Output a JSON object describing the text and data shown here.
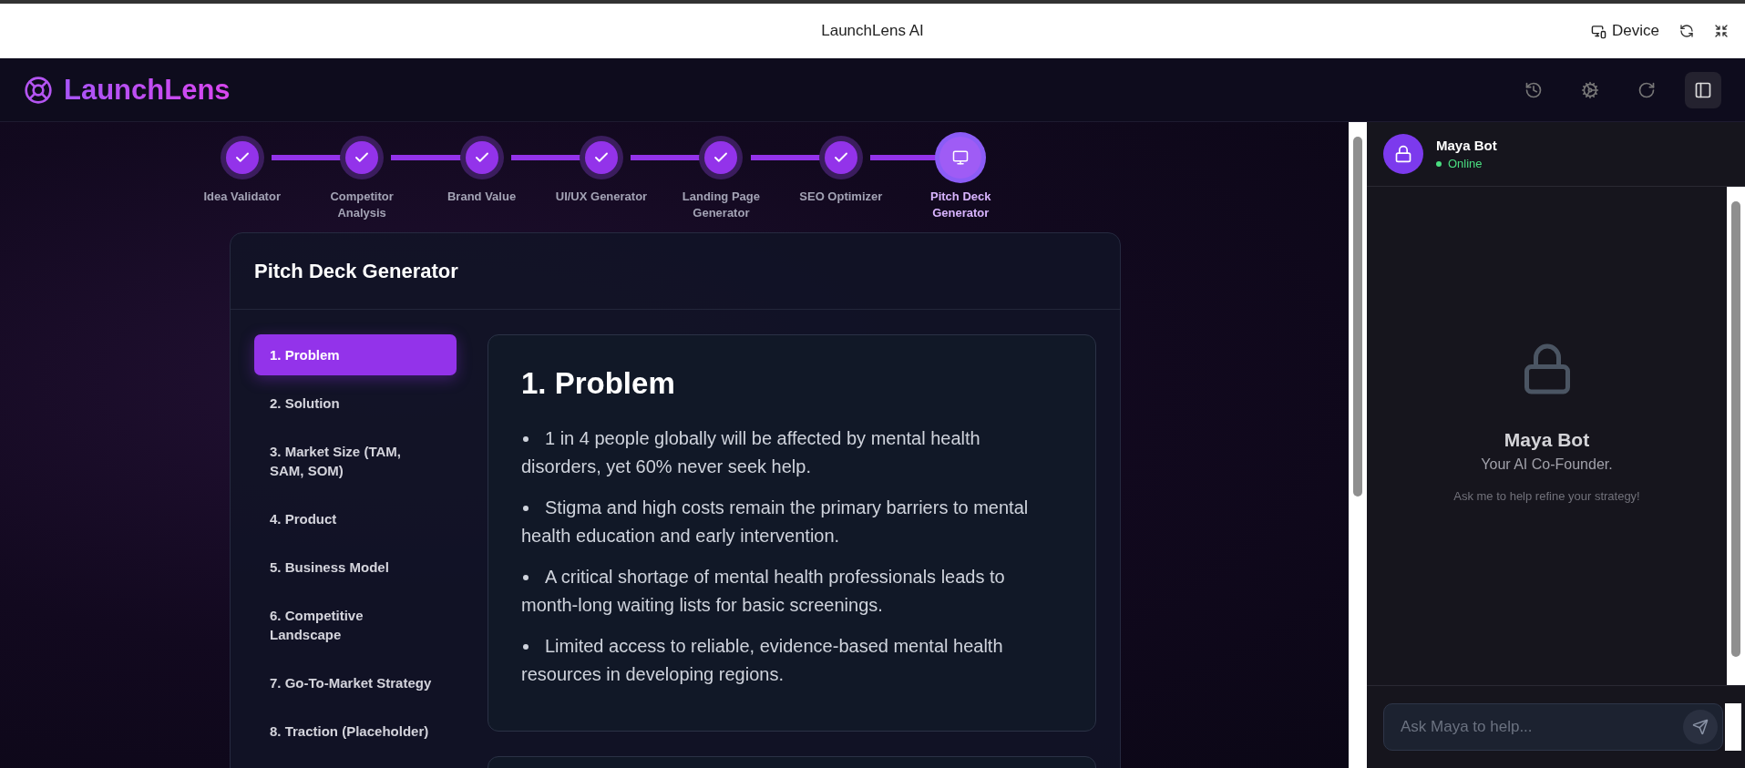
{
  "window": {
    "title": "LaunchLens AI",
    "device_label": "Device"
  },
  "app": {
    "logo": "LaunchLens"
  },
  "steps": [
    {
      "label": "Idea Validator",
      "completed": true,
      "selected": false
    },
    {
      "label": "Competitor Analysis",
      "completed": true,
      "selected": false
    },
    {
      "label": "Brand Value",
      "completed": true,
      "selected": false
    },
    {
      "label": "UI/UX Generator",
      "completed": true,
      "selected": false
    },
    {
      "label": "Landing Page Generator",
      "completed": true,
      "selected": false
    },
    {
      "label": "SEO Optimizer",
      "completed": true,
      "selected": false
    },
    {
      "label": "Pitch Deck Generator",
      "completed": false,
      "selected": true
    }
  ],
  "card": {
    "title": "Pitch Deck Generator",
    "sections": [
      {
        "label": "1. Problem",
        "selected": true
      },
      {
        "label": "2. Solution",
        "selected": false
      },
      {
        "label": "3. Market Size (TAM, SAM, SOM)",
        "selected": false
      },
      {
        "label": "4. Product",
        "selected": false
      },
      {
        "label": "5. Business Model",
        "selected": false
      },
      {
        "label": "6. Competitive Landscape",
        "selected": false
      },
      {
        "label": "7. Go-To-Market Strategy",
        "selected": false
      },
      {
        "label": "8. Traction (Placeholder)",
        "selected": false
      }
    ],
    "slide": {
      "title": "1. Problem",
      "bullets": [
        "1 in 4 people globally will be affected by mental health disorders, yet 60% never seek help.",
        "Stigma and high costs remain the primary barriers to mental health education and early intervention.",
        "A critical shortage of mental health professionals leads to month-long waiting lists for basic screenings.",
        "Limited access to reliable, evidence-based mental health resources in developing regions."
      ]
    }
  },
  "chat": {
    "bot_name": "Maya Bot",
    "status": "Online",
    "online": true,
    "empty_title": "Maya Bot",
    "empty_subtitle": "Your AI Co-Founder.",
    "empty_hint": "Ask me to help refine your strategy!",
    "input": {
      "placeholder": "Ask Maya to help..."
    }
  }
}
